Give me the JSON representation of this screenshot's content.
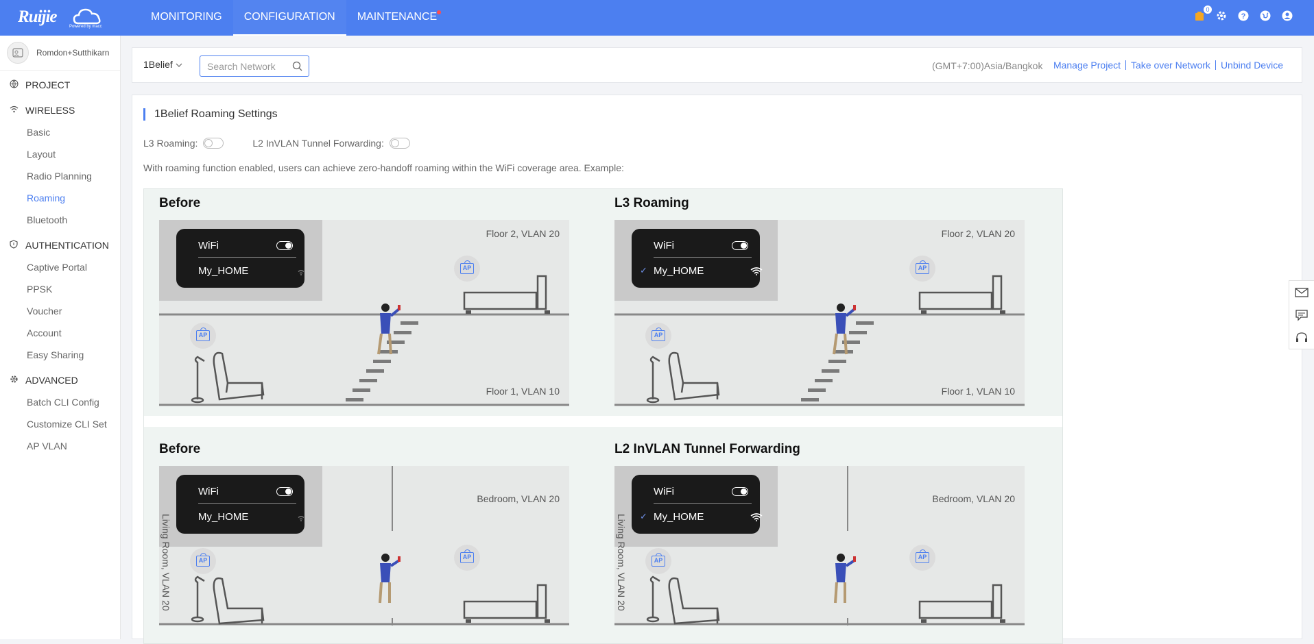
{
  "header": {
    "logo_text": "Ruijie",
    "logo_sub": "Powered by macc",
    "nav": [
      {
        "label": "MONITORING"
      },
      {
        "label": "CONFIGURATION"
      },
      {
        "label": "MAINTENANCE"
      }
    ],
    "notification_count": "0",
    "icons": [
      "notification-icon",
      "settings-icon",
      "help-icon",
      "globe-icon",
      "user-icon"
    ]
  },
  "sidebar": {
    "user": "Romdon+Sutthikarn",
    "sections": [
      {
        "label": "PROJECT",
        "icon": "globe-icon",
        "items": []
      },
      {
        "label": "WIRELESS",
        "icon": "wifi-icon",
        "items": [
          "Basic",
          "Layout",
          "Radio Planning",
          "Roaming",
          "Bluetooth"
        ]
      },
      {
        "label": "AUTHENTICATION",
        "icon": "shield-icon",
        "items": [
          "Captive Portal",
          "PPSK",
          "Voucher",
          "Account",
          "Easy Sharing"
        ]
      },
      {
        "label": "ADVANCED",
        "icon": "gear-icon",
        "items": [
          "Batch CLI Config",
          "Customize CLI Set",
          "AP VLAN"
        ]
      }
    ],
    "active_item": "Roaming"
  },
  "filterbar": {
    "project": "1Belief",
    "search_placeholder": "Search Network",
    "timezone": "(GMT+7:00)Asia/Bangkok",
    "links": [
      "Manage Project",
      "Take over Network",
      "Unbind Device"
    ]
  },
  "roaming": {
    "title": "1Belief Roaming Settings",
    "l3_label": "L3 Roaming:",
    "l3_enabled": false,
    "l2_label": "L2 InVLAN Tunnel Forwarding:",
    "l2_enabled": false,
    "description": "With roaming function enabled, users can achieve zero-handoff roaming within the WiFi coverage area. Example:"
  },
  "illustration": {
    "panels": [
      {
        "title": "Before",
        "wifi": "WiFi",
        "network": "My_HOME",
        "connected": false,
        "upper": "Floor 2, VLAN 20",
        "lower": "Floor 1, VLAN 10",
        "ap_label": "AP"
      },
      {
        "title": "L3 Roaming",
        "wifi": "WiFi",
        "network": "My_HOME",
        "connected": true,
        "upper": "Floor 2, VLAN 20",
        "lower": "Floor 1, VLAN 10",
        "ap_label": "AP"
      },
      {
        "title": "Before",
        "wifi": "WiFi",
        "network": "My_HOME",
        "connected": false,
        "room_left": "Living Room, VLAN 20",
        "room_right": "Bedroom, VLAN 20",
        "ap_label": "AP"
      },
      {
        "title": "L2 InVLAN Tunnel Forwarding",
        "wifi": "WiFi",
        "network": "My_HOME",
        "connected": true,
        "room_left": "Living Room, VLAN 20",
        "room_right": "Bedroom, VLAN 20",
        "ap_label": "AP"
      }
    ]
  },
  "floatbar": [
    "mail-icon",
    "chat-icon",
    "headset-icon"
  ]
}
